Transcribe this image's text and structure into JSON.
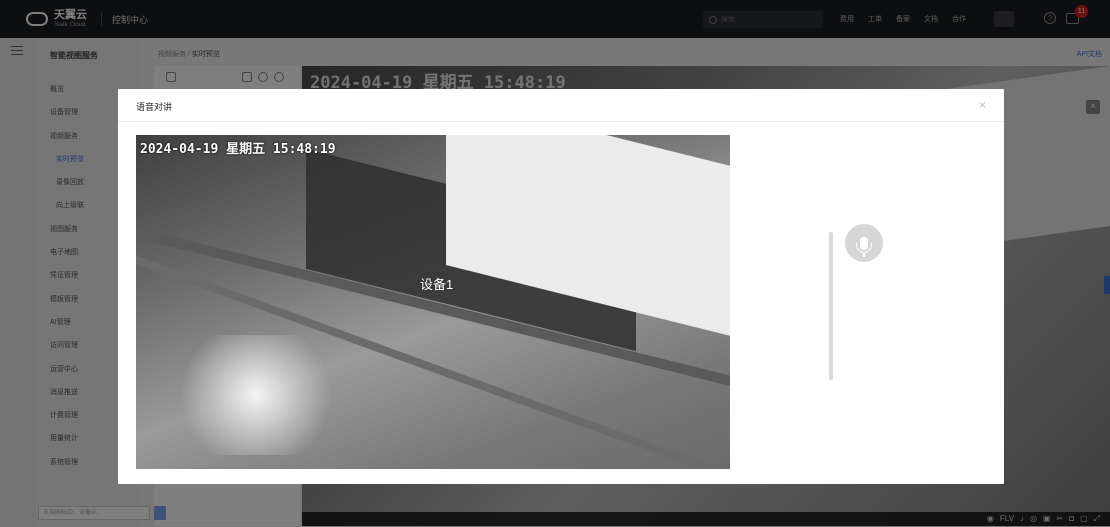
{
  "topbar": {
    "brand_cn": "天翼云",
    "brand_en": "State Cloud",
    "console_label": "控制中心",
    "search_placeholder": "搜索",
    "menu": [
      "费用",
      "工单",
      "备案",
      "文档",
      "合作"
    ],
    "message_count": "11"
  },
  "sidebar": {
    "title": "智能视图服务",
    "items": [
      {
        "label": "概览",
        "sub": false,
        "active": false
      },
      {
        "label": "设备管理",
        "sub": false,
        "active": false
      },
      {
        "label": "视频服务",
        "sub": false,
        "active": false
      },
      {
        "label": "实时预览",
        "sub": true,
        "active": true
      },
      {
        "label": "录像回放",
        "sub": true,
        "active": false
      },
      {
        "label": "向上级联",
        "sub": true,
        "active": false
      },
      {
        "label": "视图服务",
        "sub": false,
        "active": false
      },
      {
        "label": "电子地图",
        "sub": false,
        "active": false
      },
      {
        "label": "凭证管理",
        "sub": false,
        "active": false
      },
      {
        "label": "模板管理",
        "sub": false,
        "active": false
      },
      {
        "label": "AI管理",
        "sub": false,
        "active": false
      },
      {
        "label": "访问管理",
        "sub": false,
        "active": false
      },
      {
        "label": "运营中心",
        "sub": false,
        "active": false
      },
      {
        "label": "消息推送",
        "sub": false,
        "active": false
      },
      {
        "label": "计费管理",
        "sub": false,
        "active": false
      },
      {
        "label": "用量统计",
        "sub": false,
        "active": false
      },
      {
        "label": "系统管理",
        "sub": false,
        "active": false
      }
    ]
  },
  "main": {
    "breadcrumb_parent": "视频服务",
    "breadcrumb_sep": "/",
    "breadcrumb_current": "实时预览",
    "api_doc": "API文档",
    "video_timestamp": "2024-04-19 星期五 15:48:19",
    "bottom_search_placeholder": "支持国标ID、设备IP、",
    "toolbar_format": "FLV"
  },
  "modal": {
    "title": "语音对讲",
    "close_glyph": "×",
    "video_timestamp": "2024-04-19 星期五 15:48:19",
    "device_name": "设备1"
  }
}
